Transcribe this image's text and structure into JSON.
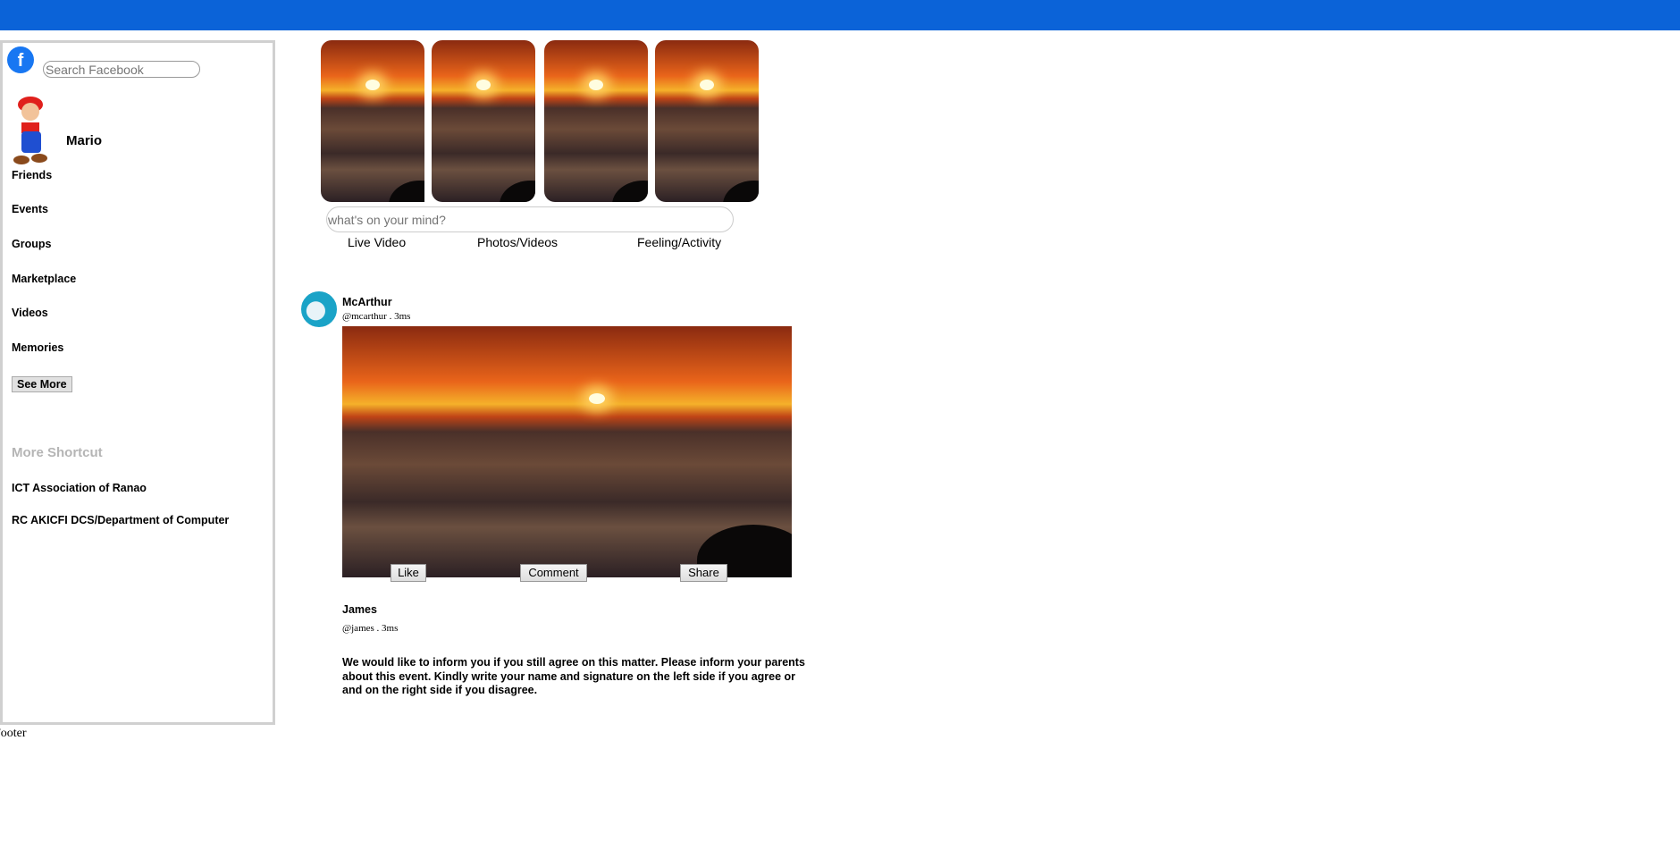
{
  "brand_color": "#0b63d8",
  "sidebar": {
    "logo_icon": "facebook-icon",
    "search_placeholder": "Search Facebook",
    "user_name": "Mario",
    "items": [
      {
        "label": "Friends"
      },
      {
        "label": "Events"
      },
      {
        "label": "Groups"
      },
      {
        "label": "Marketplace"
      },
      {
        "label": "Videos"
      },
      {
        "label": "Memories"
      }
    ],
    "see_more": "See More",
    "shortcut_heading": "More Shortcut",
    "shortcuts": [
      {
        "label": "ICT Association of Ranao"
      },
      {
        "label": "RC AKICFI DCS/Department of Computer"
      }
    ]
  },
  "composer": {
    "placeholder": "what's on your mind?",
    "actions": [
      "Live Video",
      "Photos/Videos",
      "Feeling/Activity"
    ]
  },
  "posts": [
    {
      "name": "McArthur",
      "handle": "@mcarthur . 3ms",
      "buttons": [
        "Like",
        "Comment",
        "Share"
      ]
    },
    {
      "name": "James",
      "handle": "@james . 3ms",
      "text": "We would like to inform you if you still agree on this matter. Please inform your parents about this event. Kindly write your name and signature on the left side if you agree or and on the right side if you disagree."
    }
  ],
  "footer": "Footer"
}
